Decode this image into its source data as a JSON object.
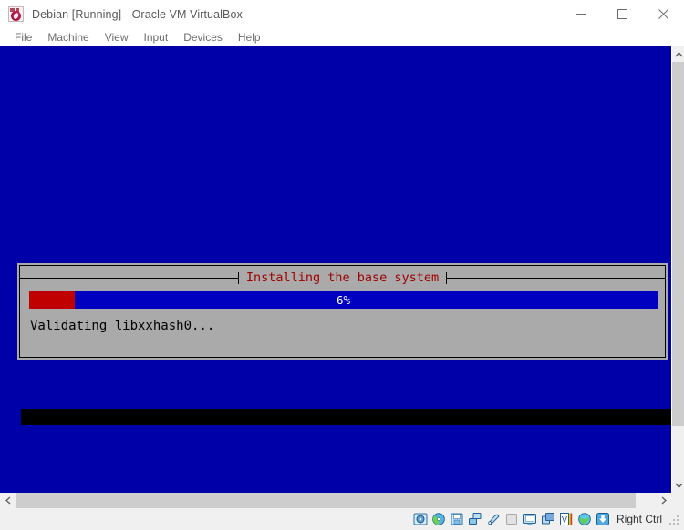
{
  "window": {
    "title": "Debian [Running] - Oracle VM VirtualBox",
    "app_icon": "virtualbox-icon",
    "controls": {
      "minimize": "minimize-icon",
      "maximize": "maximize-icon",
      "close": "close-icon"
    }
  },
  "menubar": {
    "items": [
      {
        "label": "File"
      },
      {
        "label": "Machine"
      },
      {
        "label": "View"
      },
      {
        "label": "Input"
      },
      {
        "label": "Devices"
      },
      {
        "label": "Help"
      }
    ]
  },
  "vm_screen": {
    "background_color": "#0000a8",
    "dialog": {
      "title": "Installing the base system",
      "title_color": "#a00000",
      "background_color": "#aaaaaa",
      "progress": {
        "percent_label": "6%",
        "percent_value": 6,
        "fill_color": "#c00000",
        "track_color": "#0000c0",
        "text_color": "#ffffff"
      },
      "status_text": "Validating libxxhash0..."
    }
  },
  "scrollbars": {
    "vertical": {
      "up_arrow": "chevron-up-icon",
      "down_arrow": "chevron-down-icon"
    },
    "horizontal": {
      "left_arrow": "chevron-left-icon",
      "right_arrow": "chevron-right-icon"
    }
  },
  "statusbar": {
    "icons": [
      {
        "name": "hard-disk-icon"
      },
      {
        "name": "optical-disk-icon"
      },
      {
        "name": "floppy-disk-icon"
      },
      {
        "name": "network-icon"
      },
      {
        "name": "usb-icon"
      },
      {
        "name": "shared-folders-icon"
      },
      {
        "name": "display-icon"
      },
      {
        "name": "recording-icon"
      },
      {
        "name": "vm-features-icon"
      },
      {
        "name": "mouse-integration-icon"
      },
      {
        "name": "host-key-icon"
      }
    ],
    "host_key_label": "Right Ctrl",
    "resize_grip": "resize-grip-icon"
  }
}
